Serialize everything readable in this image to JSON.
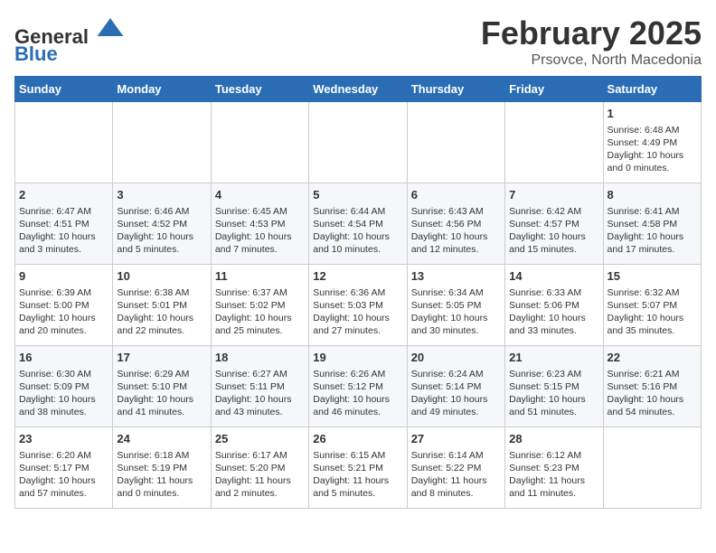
{
  "header": {
    "logo_line1": "General",
    "logo_line2": "Blue",
    "title": "February 2025",
    "subtitle": "Prsovce, North Macedonia"
  },
  "days_of_week": [
    "Sunday",
    "Monday",
    "Tuesday",
    "Wednesday",
    "Thursday",
    "Friday",
    "Saturday"
  ],
  "weeks": [
    [
      {
        "day": "",
        "info": ""
      },
      {
        "day": "",
        "info": ""
      },
      {
        "day": "",
        "info": ""
      },
      {
        "day": "",
        "info": ""
      },
      {
        "day": "",
        "info": ""
      },
      {
        "day": "",
        "info": ""
      },
      {
        "day": "1",
        "info": "Sunrise: 6:48 AM\nSunset: 4:49 PM\nDaylight: 10 hours\nand 0 minutes."
      }
    ],
    [
      {
        "day": "2",
        "info": "Sunrise: 6:47 AM\nSunset: 4:51 PM\nDaylight: 10 hours\nand 3 minutes."
      },
      {
        "day": "3",
        "info": "Sunrise: 6:46 AM\nSunset: 4:52 PM\nDaylight: 10 hours\nand 5 minutes."
      },
      {
        "day": "4",
        "info": "Sunrise: 6:45 AM\nSunset: 4:53 PM\nDaylight: 10 hours\nand 7 minutes."
      },
      {
        "day": "5",
        "info": "Sunrise: 6:44 AM\nSunset: 4:54 PM\nDaylight: 10 hours\nand 10 minutes."
      },
      {
        "day": "6",
        "info": "Sunrise: 6:43 AM\nSunset: 4:56 PM\nDaylight: 10 hours\nand 12 minutes."
      },
      {
        "day": "7",
        "info": "Sunrise: 6:42 AM\nSunset: 4:57 PM\nDaylight: 10 hours\nand 15 minutes."
      },
      {
        "day": "8",
        "info": "Sunrise: 6:41 AM\nSunset: 4:58 PM\nDaylight: 10 hours\nand 17 minutes."
      }
    ],
    [
      {
        "day": "9",
        "info": "Sunrise: 6:39 AM\nSunset: 5:00 PM\nDaylight: 10 hours\nand 20 minutes."
      },
      {
        "day": "10",
        "info": "Sunrise: 6:38 AM\nSunset: 5:01 PM\nDaylight: 10 hours\nand 22 minutes."
      },
      {
        "day": "11",
        "info": "Sunrise: 6:37 AM\nSunset: 5:02 PM\nDaylight: 10 hours\nand 25 minutes."
      },
      {
        "day": "12",
        "info": "Sunrise: 6:36 AM\nSunset: 5:03 PM\nDaylight: 10 hours\nand 27 minutes."
      },
      {
        "day": "13",
        "info": "Sunrise: 6:34 AM\nSunset: 5:05 PM\nDaylight: 10 hours\nand 30 minutes."
      },
      {
        "day": "14",
        "info": "Sunrise: 6:33 AM\nSunset: 5:06 PM\nDaylight: 10 hours\nand 33 minutes."
      },
      {
        "day": "15",
        "info": "Sunrise: 6:32 AM\nSunset: 5:07 PM\nDaylight: 10 hours\nand 35 minutes."
      }
    ],
    [
      {
        "day": "16",
        "info": "Sunrise: 6:30 AM\nSunset: 5:09 PM\nDaylight: 10 hours\nand 38 minutes."
      },
      {
        "day": "17",
        "info": "Sunrise: 6:29 AM\nSunset: 5:10 PM\nDaylight: 10 hours\nand 41 minutes."
      },
      {
        "day": "18",
        "info": "Sunrise: 6:27 AM\nSunset: 5:11 PM\nDaylight: 10 hours\nand 43 minutes."
      },
      {
        "day": "19",
        "info": "Sunrise: 6:26 AM\nSunset: 5:12 PM\nDaylight: 10 hours\nand 46 minutes."
      },
      {
        "day": "20",
        "info": "Sunrise: 6:24 AM\nSunset: 5:14 PM\nDaylight: 10 hours\nand 49 minutes."
      },
      {
        "day": "21",
        "info": "Sunrise: 6:23 AM\nSunset: 5:15 PM\nDaylight: 10 hours\nand 51 minutes."
      },
      {
        "day": "22",
        "info": "Sunrise: 6:21 AM\nSunset: 5:16 PM\nDaylight: 10 hours\nand 54 minutes."
      }
    ],
    [
      {
        "day": "23",
        "info": "Sunrise: 6:20 AM\nSunset: 5:17 PM\nDaylight: 10 hours\nand 57 minutes."
      },
      {
        "day": "24",
        "info": "Sunrise: 6:18 AM\nSunset: 5:19 PM\nDaylight: 11 hours\nand 0 minutes."
      },
      {
        "day": "25",
        "info": "Sunrise: 6:17 AM\nSunset: 5:20 PM\nDaylight: 11 hours\nand 2 minutes."
      },
      {
        "day": "26",
        "info": "Sunrise: 6:15 AM\nSunset: 5:21 PM\nDaylight: 11 hours\nand 5 minutes."
      },
      {
        "day": "27",
        "info": "Sunrise: 6:14 AM\nSunset: 5:22 PM\nDaylight: 11 hours\nand 8 minutes."
      },
      {
        "day": "28",
        "info": "Sunrise: 6:12 AM\nSunset: 5:23 PM\nDaylight: 11 hours\nand 11 minutes."
      },
      {
        "day": "",
        "info": ""
      }
    ]
  ]
}
